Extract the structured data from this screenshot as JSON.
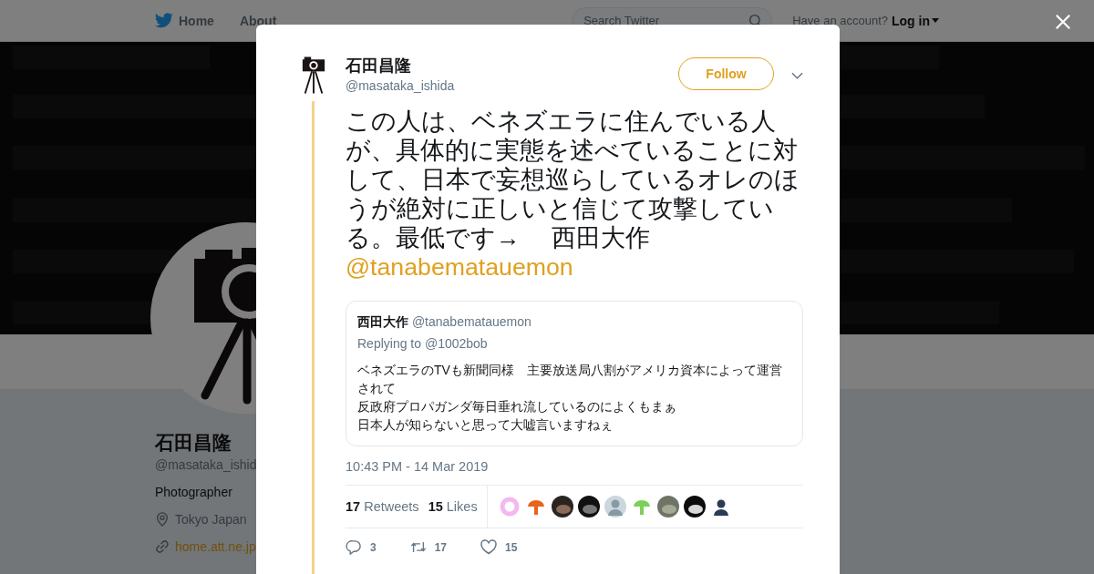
{
  "nav": {
    "items": [
      {
        "label": "Home",
        "kind": "home"
      },
      {
        "label": "About",
        "kind": "plain"
      }
    ],
    "search": {
      "placeholder": "Search Twitter"
    },
    "account_prompt": "Have an account?",
    "login": "Log in"
  },
  "profile": {
    "name": "石田昌隆",
    "handle": "@masataka_ishid",
    "bio": "Photographer",
    "location": "Tokyo Japan",
    "website": "home.att.ne.jp"
  },
  "tweet": {
    "author": {
      "name": "石田昌隆",
      "handle": "@masataka_ishida"
    },
    "follow_button": "Follow",
    "text": "この人は、ベネズエラに住んでいる人が、具体的に実態を述べていることに対して、日本で妄想巡らしているオレのほうが絶対に正しいと信じて攻撃している。最低です→　 西田大作",
    "mention": "@tanabematauemon",
    "quote": {
      "name": "西田大作",
      "handle": "@tanabematauemon",
      "replying": "Replying to @1002bob",
      "lines": [
        "ベネズエラのTVも新聞同様　主要放送局八割がアメリカ資本によって運営されて",
        "反政府プロパガンダ毎日垂れ流しているのによくもまぁ",
        "日本人が知らないと思って大嘘言いますねぇ"
      ]
    },
    "timestamp": "10:43 PM - 14 Mar 2019",
    "retweets": {
      "count": "17",
      "label": "Retweets"
    },
    "likes": {
      "count": "15",
      "label": "Likes"
    },
    "actions": [
      {
        "kind": "reply",
        "count": "3"
      },
      {
        "kind": "retweet",
        "count": "17"
      },
      {
        "kind": "like",
        "count": "15"
      }
    ]
  }
}
